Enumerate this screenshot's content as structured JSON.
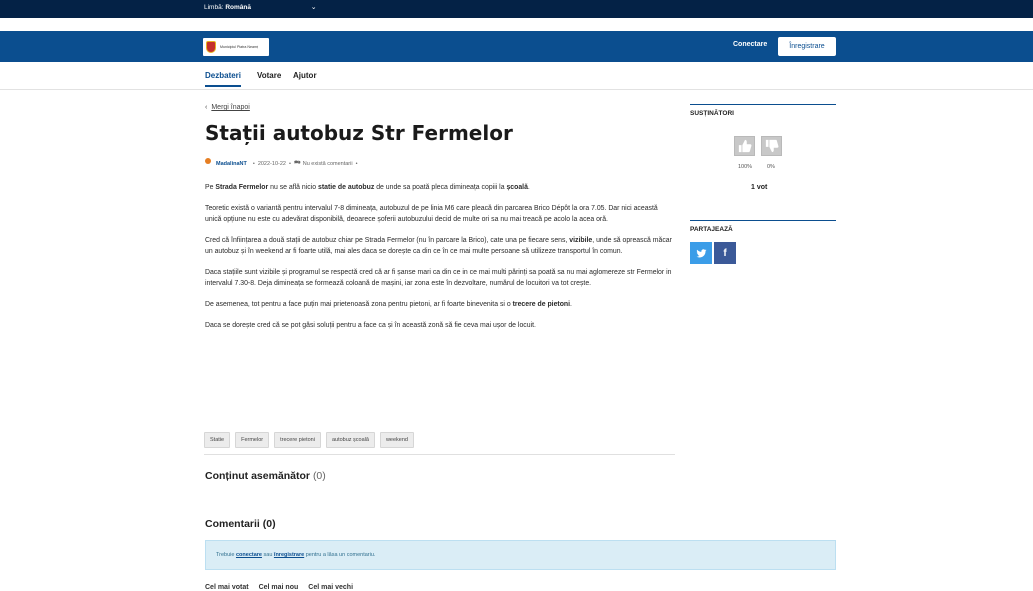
{
  "topbar": {
    "language_label": "Limbă:",
    "language_value": "Română",
    "chevron_icon": "chevron-down-icon"
  },
  "header": {
    "logo_text": "Municipiul Piatra Neamț",
    "login_label": "Conectare",
    "register_label": "Înregistrare"
  },
  "nav": {
    "items": [
      {
        "label": "Dezbateri"
      },
      {
        "label": "Votare"
      },
      {
        "label": "Ajutor"
      }
    ]
  },
  "post": {
    "back_label": "Mergi înapoi",
    "title": "Stații autobuz Str Fermelor",
    "author": "MadalinaNT",
    "date": "2022-10-22",
    "comments_info": "Nu există comentarii",
    "paragraphs": [
      "Pe Strada Fermelor nu se află nicio statie de autobuz de unde sa poată pleca dimineața copiii la școală.",
      "Teoretic există o variantă pentru intervalul 7-8 dimineața, autobuzul de pe linia M6 care pleacă din parcarea Brico Dépôt la ora 7.05. Dar nici această unică opțiune nu este cu adevărat disponibilă, deoarece șoferii autobuzului decid de multe ori sa nu mai treacă pe acolo la acea oră.",
      "Cred că înființarea a două stații de autobuz chiar pe Strada Fermelor (nu în parcare la Brico), cate una pe fiecare sens, vizibile, unde să oprească măcar un autobuz și în weekend ar fi foarte utilă, mai ales daca se dorește ca din ce în ce mai multe persoane să utilizeze transportul în comun.",
      "Daca stațiile sunt vizibile și programul se respectă cred că ar fi șanse mari ca din ce in ce mai multi părinți sa poată sa nu mai aglomereze str Fermelor in intervalul 7.30-8. Deja dimineața se formează coloană de mașini, iar zona este în dezvoltare, numărul de locuitori va tot crește.",
      "De asemenea, tot pentru a face puțin mai prietenoasă zona pentru pietoni, ar fi foarte binevenita si o trecere de pietoni.",
      "Daca se dorește cred că se pot găsi soluții pentru a face ca și în această zonă să fie ceva mai ușor de locuit."
    ],
    "tags": [
      "Statie",
      "Fermelor",
      "trecere pietoni",
      "autobuz școală",
      "weekend"
    ]
  },
  "similar": {
    "label": "Conținut asemănător",
    "count": "(0)"
  },
  "comments": {
    "title": "Comentarii (0)",
    "notice_prefix": "Trebuie",
    "notice_login": "conectare",
    "notice_mid": "sau",
    "notice_register": "înregistrare",
    "notice_suffix": "pentru a lăsa un comentariu.",
    "sort_options": [
      "Cel mai votat",
      "Cel mai nou",
      "Cel mai vechi"
    ]
  },
  "sidebar": {
    "supporters_title": "SUSȚINĂTORI",
    "up_pct": "100%",
    "down_pct": "0%",
    "votes_count": "1 vot",
    "share_title": "PARTAJEAZĂ",
    "share_icons": [
      "twitter-icon",
      "facebook-icon"
    ]
  },
  "colors": {
    "topbar": "#042246",
    "header": "#0b4e8f",
    "twitter": "#3b9de8",
    "facebook": "#3b5998",
    "notice_bg": "#daedf6"
  }
}
